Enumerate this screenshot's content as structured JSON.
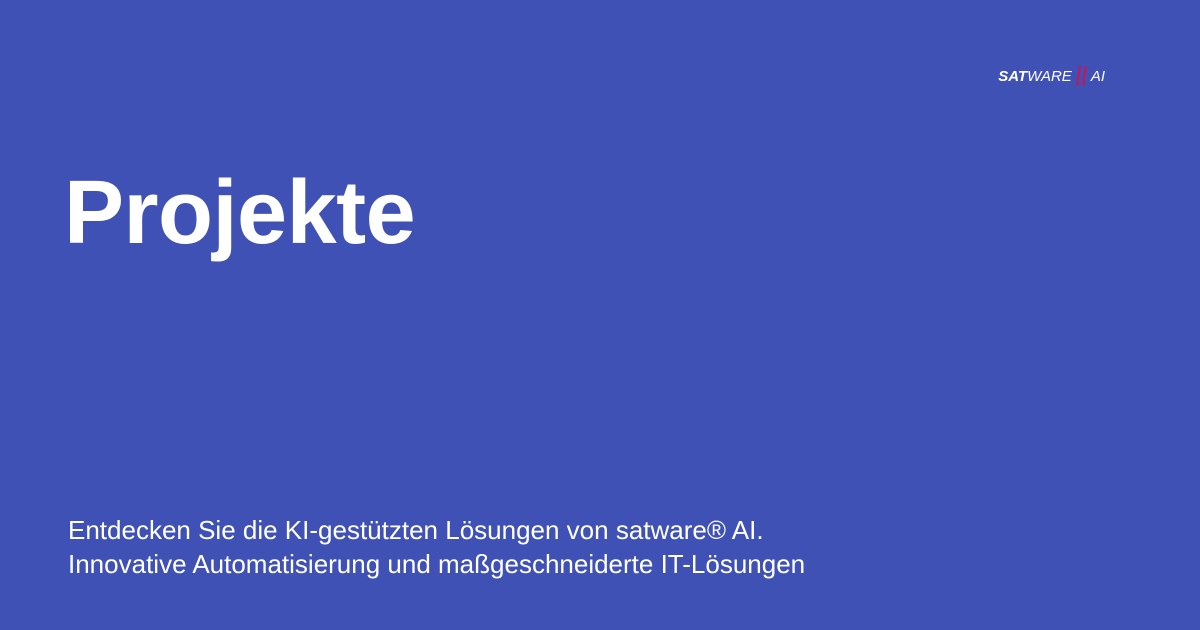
{
  "brand": {
    "logo_sat": "SAT",
    "logo_ware": "WARE",
    "logo_ai": "AI",
    "accent_color": "#c2185b"
  },
  "colors": {
    "background": "#3f51b5",
    "text": "#ffffff"
  },
  "page": {
    "title": "Projekte",
    "subtitle_lines": [
      "Entdecken Sie die KI-gestützten Lösungen von satware® AI.",
      "Innovative Automatisierung und maßgeschneiderte IT-Lösungen"
    ]
  }
}
